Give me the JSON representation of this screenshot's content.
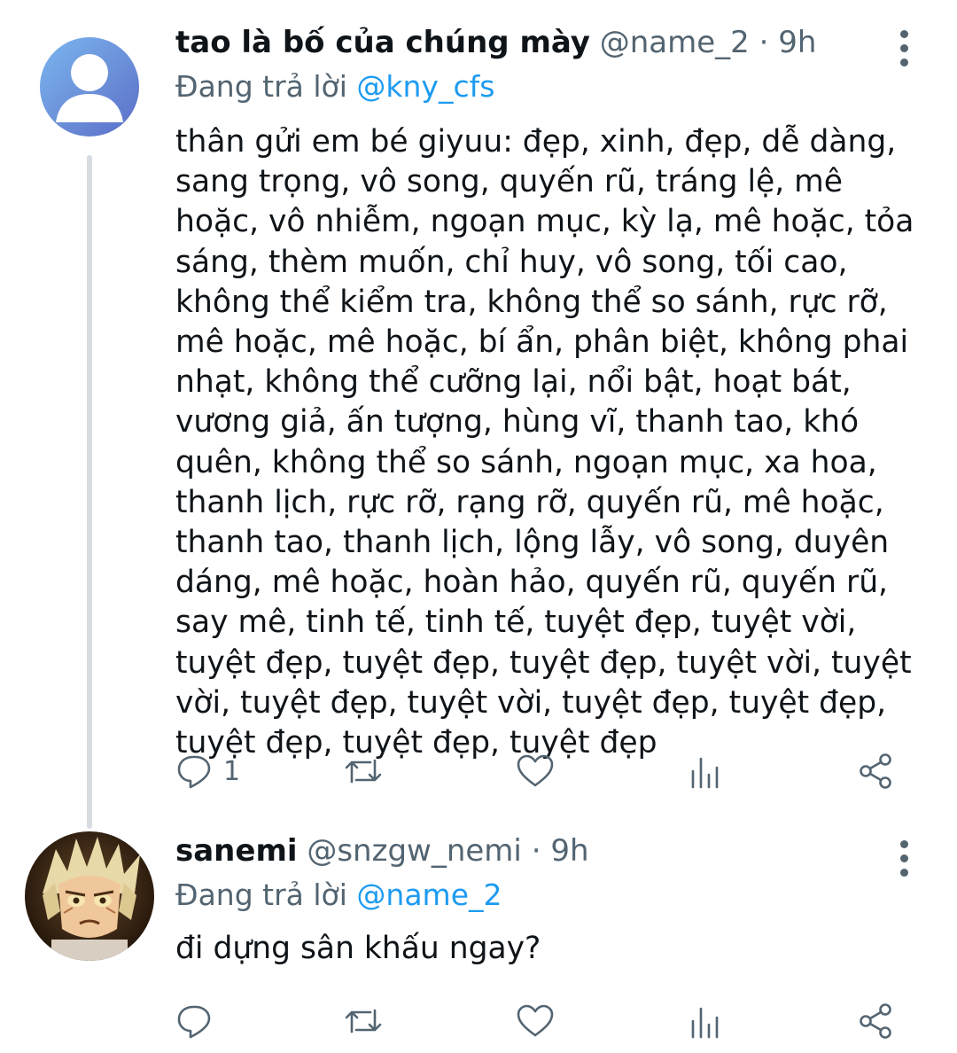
{
  "tweets": [
    {
      "display_name": "tao là bố của chúng mày",
      "handle": "@name_2",
      "separator": "·",
      "time": "9h",
      "reply_prefix": "Đang trả lời",
      "reply_to": "@kny_cfs",
      "text": "thân gửi em bé giyuu: đẹp, xinh, đẹp, dễ dàng, sang trọng, vô song, quyến rũ, tráng lệ, mê hoặc, vô nhiễm, ngoạn mục, kỳ lạ, mê hoặc, tỏa sáng, thèm muốn, chỉ huy, vô song, tối cao, không thể kiểm tra, không thể so sánh, rực rỡ, mê hoặc, mê hoặc, bí ẩn, phân biệt, không phai nhạt, không thể cưỡng lại, nổi bật, hoạt bát, vương giả, ấn tượng, hùng vĩ, thanh tao, khó quên, không thể so sánh, ngoạn mục, xa hoa, thanh lịch, rực rỡ, rạng rỡ, quyến rũ, mê hoặc, thanh tao, thanh lịch, lộng lẫy, vô song, duyên dáng, mê hoặc, hoàn hảo, quyến rũ, quyến rũ, say mê, tinh tế, tinh tế, tuyệt đẹp, tuyệt vời, tuyệt đẹp, tuyệt đẹp, tuyệt đẹp, tuyệt vời, tuyệt vời, tuyệt đẹp, tuyệt vời, tuyệt đẹp, tuyệt đẹp, tuyệt đẹp, tuyệt đẹp, tuyệt đẹp",
      "reply_count": "1",
      "avatar_icon": "default-user-avatar-icon"
    },
    {
      "display_name": "sanemi",
      "handle": "@snzgw_nemi",
      "separator": "·",
      "time": "9h",
      "reply_prefix": "Đang trả lời",
      "reply_to": "@name_2",
      "text": "đi dựng sân khấu ngay?",
      "reply_count": "",
      "avatar_icon": "anime-character-avatar"
    }
  ],
  "icons": [
    "reply-icon",
    "retweet-icon",
    "like-icon",
    "analytics-icon",
    "share-icon",
    "more-options-icon"
  ],
  "colors": {
    "text": "#0f1419",
    "secondary": "#536471",
    "link": "#1d9bf0",
    "thread_line": "#d6dce1"
  }
}
